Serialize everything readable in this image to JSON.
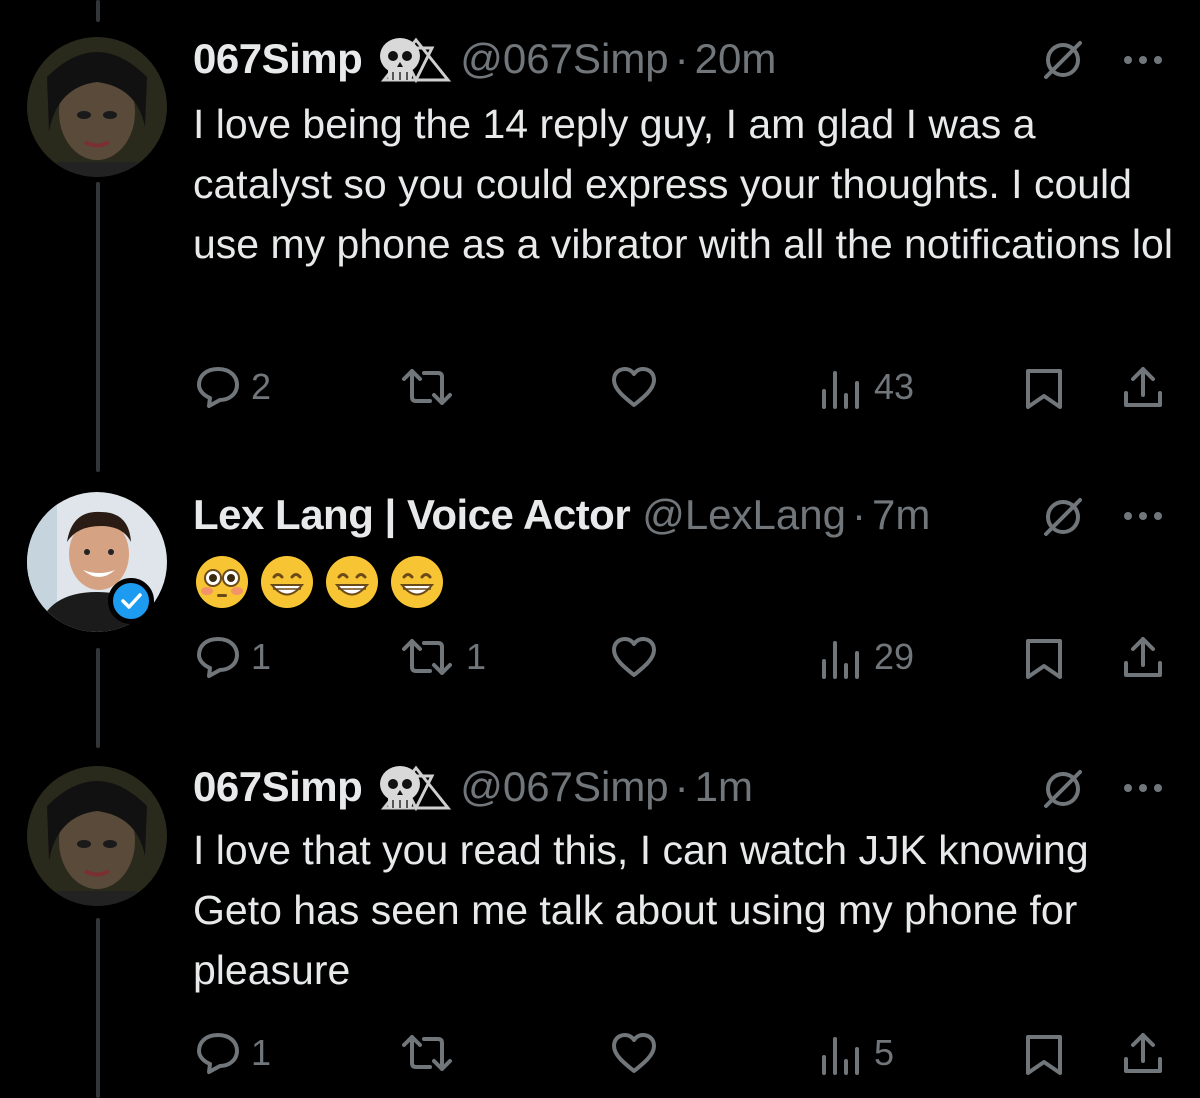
{
  "tweets": [
    {
      "name": "067Simp",
      "handle": "@067Simp",
      "time": "20m",
      "text": "I love being the 14 reply guy, I am glad I was a catalyst so you could express your thoughts. I could use my phone as a vibrator with all the notifications lol",
      "replies": "2",
      "retweets": "",
      "likes": "",
      "views": "43"
    },
    {
      "name": "Lex Lang | Voice Actor",
      "handle": "@LexLang",
      "time": "7m",
      "text": "😳😁😁😁",
      "replies": "1",
      "retweets": "1",
      "likes": "",
      "views": "29"
    },
    {
      "name": "067Simp",
      "handle": "@067Simp",
      "time": "1m",
      "text": "I love that you read this, I can watch JJK knowing Geto has seen me talk about using my phone for pleasure",
      "replies": "1",
      "retweets": "",
      "likes": "",
      "views": "5"
    }
  ],
  "separator": "·",
  "colors": {
    "background": "#000000",
    "text": "#e7e9ea",
    "muted": "#71767b",
    "verified": "#1d9bf0",
    "thread": "#333639"
  },
  "icons": [
    "reply-icon",
    "retweet-icon",
    "like-icon",
    "views-icon",
    "bookmark-icon",
    "share-icon",
    "grok-icon",
    "more-icon",
    "skull-icon",
    "verified-icon"
  ]
}
